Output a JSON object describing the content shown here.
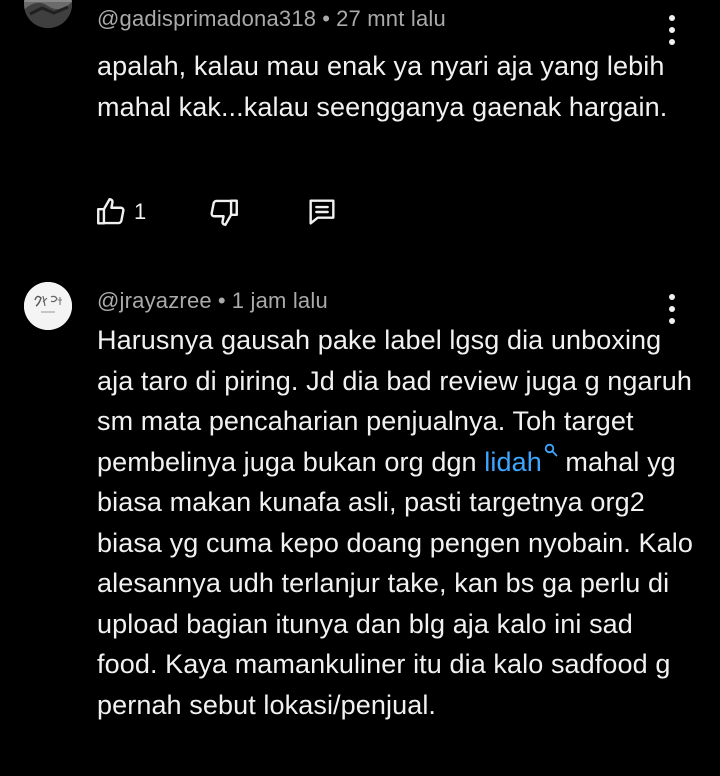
{
  "comments": [
    {
      "author": "@gadisprimadona318",
      "separator": "•",
      "time": "27 mnt lalu",
      "text": "apalah, kalau mau enak ya nyari aja yang lebih mahal kak...kalau seengganya gaenak hargain.",
      "like_count": "1",
      "icons": {
        "avatar": "avatar-image",
        "like": "thumbs-up-icon",
        "dislike": "thumbs-down-icon",
        "reply": "reply-comment-icon",
        "menu": "more-vert-icon"
      }
    },
    {
      "author": "@jrayazree",
      "separator": "•",
      "time": "1 jam lalu",
      "text_before_link": "Harusnya gausah pake label lgsg dia unboxing aja taro di piring. Jd dia bad review juga g ngaruh sm mata pencaharian penjualnya. Toh target pembelinya juga bukan org dgn ",
      "link_text": "lidah",
      "text_after_link": " mahal yg biasa makan kunafa asli, pasti targetnya org2 biasa yg cuma kepo doang pengen nyobain. Kalo alesannya udh terlanjur take, kan bs ga perlu di upload bagian itunya dan blg aja kalo ini sad food. Kaya mamankuliner itu dia kalo sadfood g pernah sebut lokasi/penjual.",
      "icons": {
        "avatar": "avatar-image",
        "search": "search-icon",
        "menu": "more-vert-icon"
      }
    }
  ],
  "colors": {
    "background": "#000000",
    "text": "#f1f1f1",
    "meta": "#aaaaaa",
    "link": "#3ea6ff"
  }
}
